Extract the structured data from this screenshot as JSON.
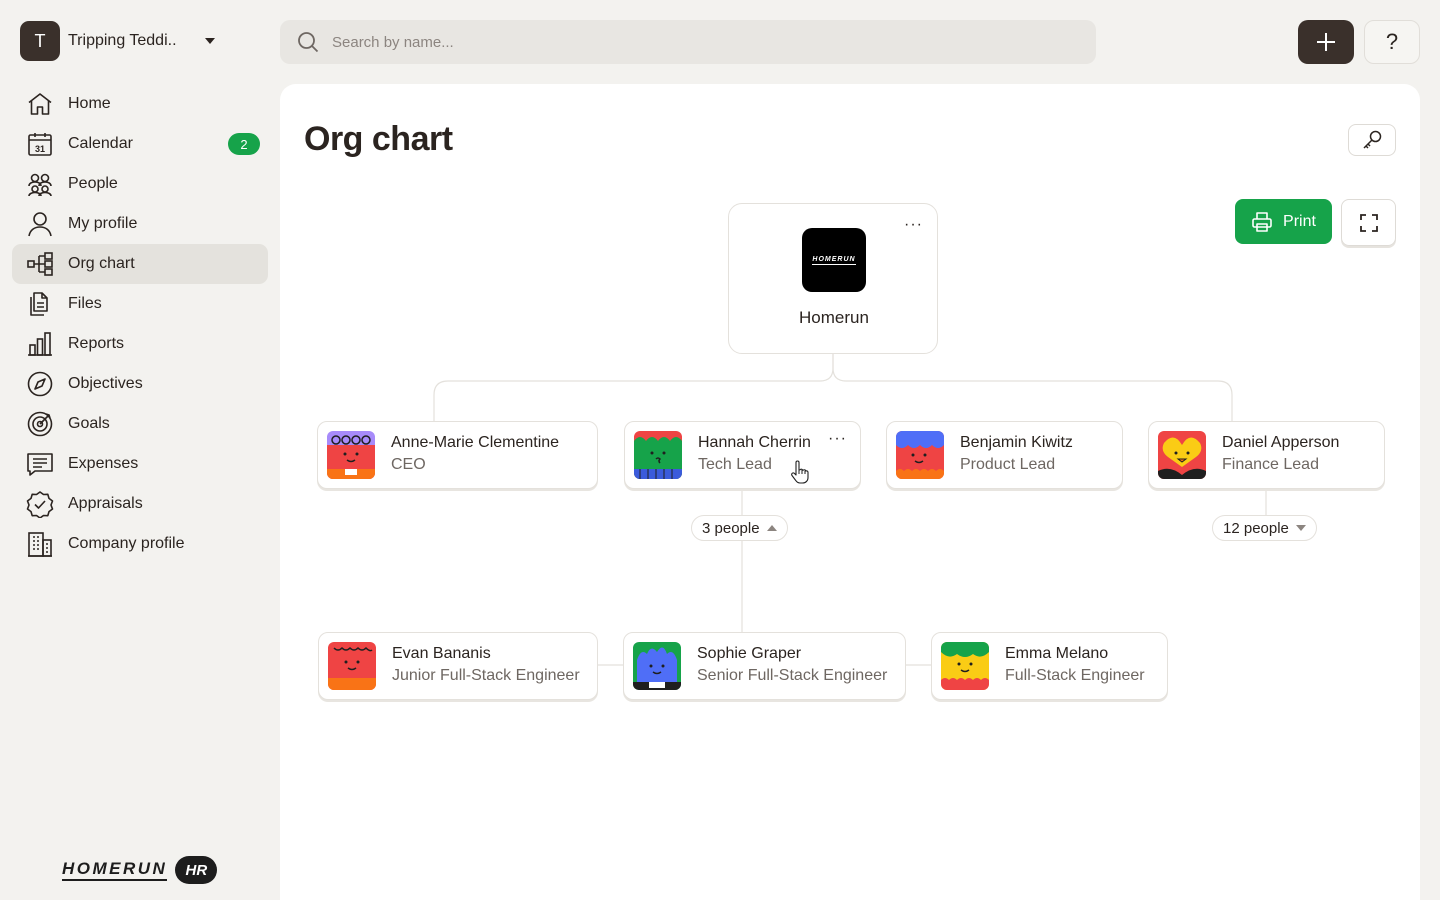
{
  "workspace": {
    "initial": "T",
    "name": "Tripping Teddi.."
  },
  "search": {
    "placeholder": "Search by name..."
  },
  "sidebar": {
    "items": [
      {
        "label": "Home",
        "icon": "home-icon"
      },
      {
        "label": "Calendar",
        "icon": "calendar-icon",
        "badge": "2"
      },
      {
        "label": "People",
        "icon": "people-icon"
      },
      {
        "label": "My profile",
        "icon": "user-icon"
      },
      {
        "label": "Org chart",
        "icon": "org-chart-icon",
        "active": true
      },
      {
        "label": "Files",
        "icon": "files-icon"
      },
      {
        "label": "Reports",
        "icon": "bar-chart-icon"
      },
      {
        "label": "Objectives",
        "icon": "compass-icon"
      },
      {
        "label": "Goals",
        "icon": "target-icon"
      },
      {
        "label": "Expenses",
        "icon": "receipt-icon"
      },
      {
        "label": "Appraisals",
        "icon": "badge-check-icon"
      },
      {
        "label": "Company profile",
        "icon": "building-icon"
      }
    ],
    "calendar_icon_day": "31"
  },
  "brand": {
    "word": "HOMERUN",
    "suffix": "HR"
  },
  "topbar": {
    "help_label": "?"
  },
  "page": {
    "title": "Org chart",
    "print_label": "Print"
  },
  "org": {
    "root": {
      "name": "Homerun",
      "logo_text": "HOMERUN"
    },
    "level1": [
      {
        "name": "Anne-Marie Clementine",
        "role": "CEO"
      },
      {
        "name": "Hannah Cherrin",
        "role": "Tech Lead"
      },
      {
        "name": "Benjamin Kiwitz",
        "role": "Product Lead"
      },
      {
        "name": "Daniel Apperson",
        "role": "Finance Lead"
      }
    ],
    "reports_hannah": {
      "label": "3 people",
      "expanded": true
    },
    "reports_daniel": {
      "label": "12 people",
      "expanded": false
    },
    "level2": [
      {
        "name": "Evan Bananis",
        "role": "Junior Full-Stack Engineer"
      },
      {
        "name": "Sophie Graper",
        "role": "Senior Full-Stack Engineer"
      },
      {
        "name": "Emma Melano",
        "role": "Full-Stack Engineer"
      }
    ]
  },
  "colors": {
    "accent_green": "#16a34a",
    "dark": "#3a302b",
    "panel": "#ffffff",
    "background": "#f3f2ef"
  }
}
